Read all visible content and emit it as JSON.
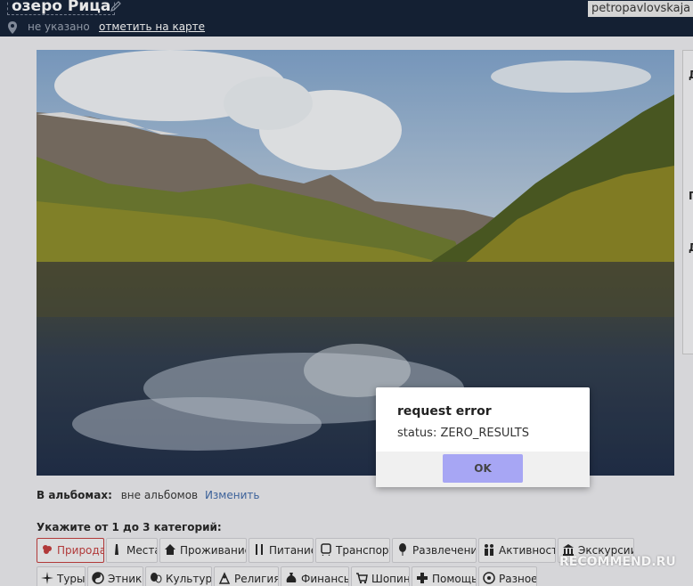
{
  "header": {
    "title": "озеро Рица",
    "username": "petropavlovskaja",
    "location_value": "не указано",
    "map_link": "отметить на карте"
  },
  "side_panel": {
    "letters": [
      "Д",
      "П",
      "Д"
    ]
  },
  "dialog": {
    "title": "request error",
    "message": "status: ZERO_RESULTS",
    "ok_label": "OK"
  },
  "albums": {
    "label": "В альбомах:",
    "value": "вне альбомов",
    "change_link": "Изменить"
  },
  "categories": {
    "title": "Укажите от 1 до 3 категорий:",
    "items": [
      {
        "label": "Природа",
        "icon": "flower-icon",
        "selected": true
      },
      {
        "label": "Места",
        "icon": "tower-icon",
        "selected": false
      },
      {
        "label": "Проживание",
        "icon": "house-icon",
        "selected": false
      },
      {
        "label": "Питание",
        "icon": "cutlery-icon",
        "selected": false
      },
      {
        "label": "Транспорт",
        "icon": "train-icon",
        "selected": false
      },
      {
        "label": "Развлечения",
        "icon": "balloon-icon",
        "selected": false
      },
      {
        "label": "Активность",
        "icon": "people-icon",
        "selected": false
      },
      {
        "label": "Экскурсии",
        "icon": "museum-icon",
        "selected": false
      },
      {
        "label": "Туры",
        "icon": "compass-icon",
        "selected": false
      },
      {
        "label": "Этника",
        "icon": "yin-yang-icon",
        "selected": false
      },
      {
        "label": "Культура",
        "icon": "masks-icon",
        "selected": false
      },
      {
        "label": "Религия",
        "icon": "religion-icon",
        "selected": false
      },
      {
        "label": "Финансы",
        "icon": "moneybag-icon",
        "selected": false
      },
      {
        "label": "Шопинг",
        "icon": "cart-icon",
        "selected": false
      },
      {
        "label": "Помощь",
        "icon": "plus-icon",
        "selected": false
      },
      {
        "label": "Разное",
        "icon": "circle-question-icon",
        "selected": false
      }
    ]
  },
  "watermark": "RECOMMEND.RU"
}
